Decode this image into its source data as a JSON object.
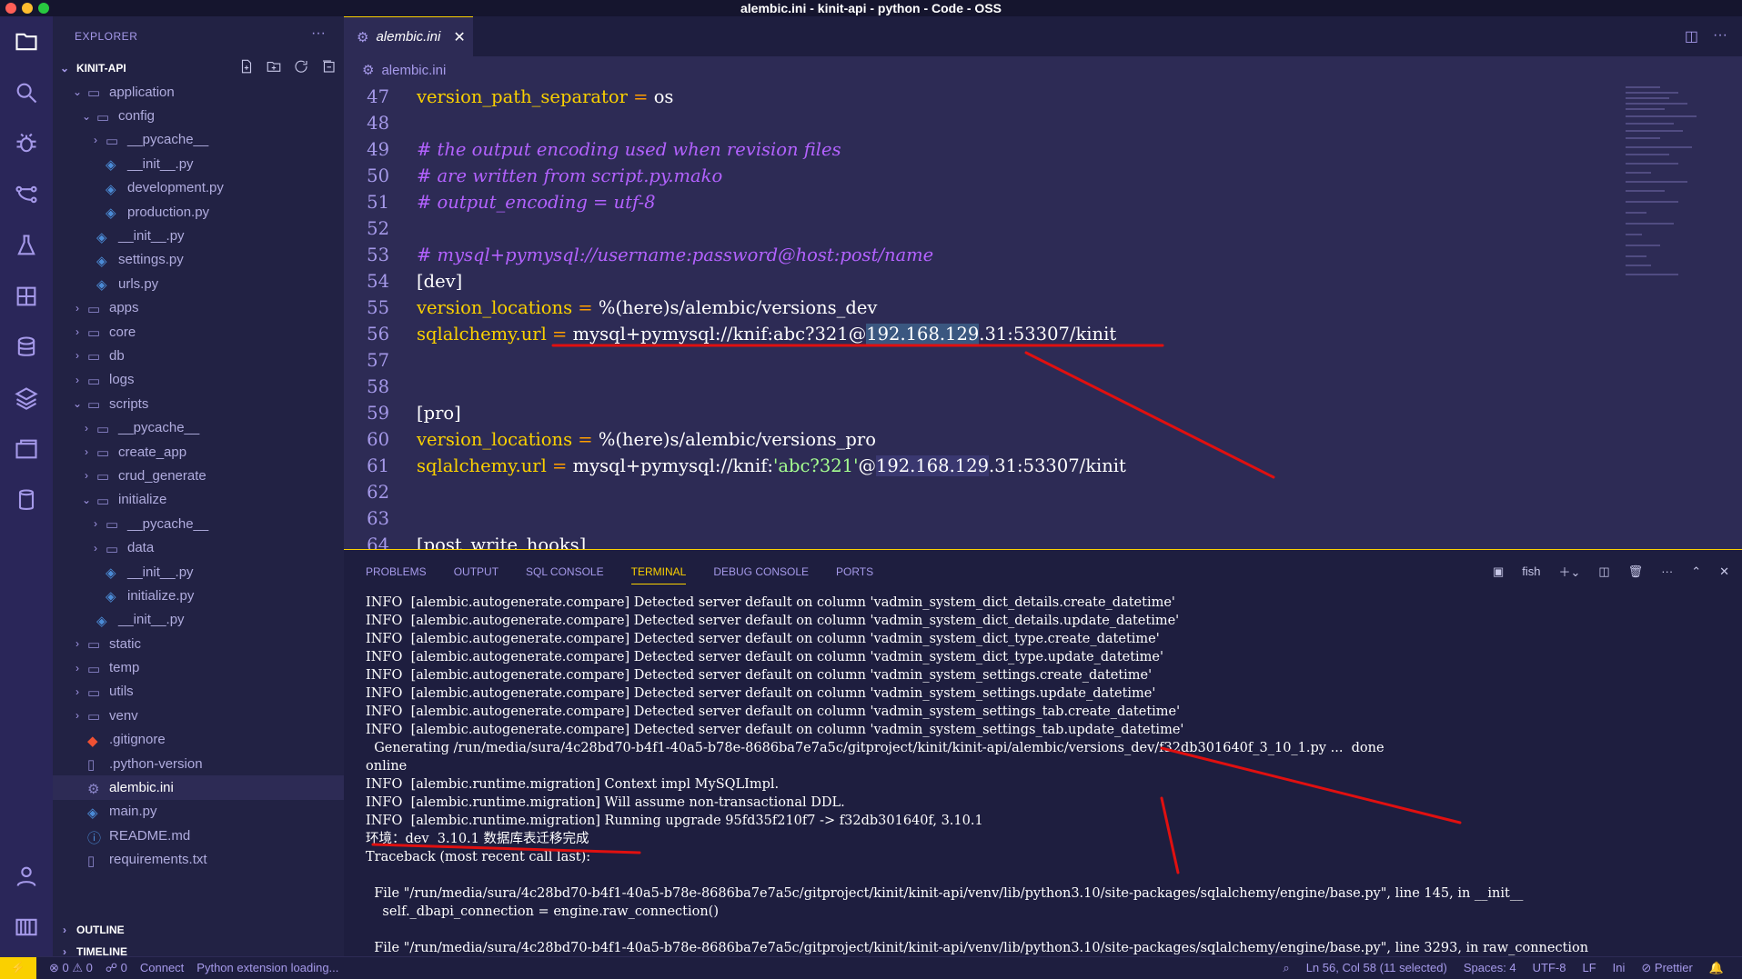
{
  "window": {
    "title": "alembic.ini - kinit-api - python - Code - OSS",
    "traffic_colors": [
      "#ff5f57",
      "#ffbd2e",
      "#28c840"
    ]
  },
  "colors": {
    "accent": "#fad000",
    "background": "#1e1e3f",
    "editor": "#2d2b55",
    "annotation": "#e01010"
  },
  "activity_bar": [
    "files-icon",
    "search-icon",
    "debug-icon",
    "source-control-icon",
    "testing-icon",
    "extensions-icon",
    "database-icon",
    "layers-icon",
    "remote-explorer-icon",
    "cylinder-icon",
    "account-icon",
    "settings-icon"
  ],
  "sidebar": {
    "header": "EXPLORER",
    "more": "···",
    "project": "KINIT-API",
    "tree": [
      {
        "label": "application",
        "depth": 1,
        "type": "folder",
        "open": true
      },
      {
        "label": "config",
        "depth": 2,
        "type": "folder",
        "open": true
      },
      {
        "label": "__pycache__",
        "depth": 3,
        "type": "folder",
        "open": false
      },
      {
        "label": "__init__.py",
        "depth": 3,
        "type": "py"
      },
      {
        "label": "development.py",
        "depth": 3,
        "type": "py"
      },
      {
        "label": "production.py",
        "depth": 3,
        "type": "py"
      },
      {
        "label": "__init__.py",
        "depth": 2,
        "type": "py"
      },
      {
        "label": "settings.py",
        "depth": 2,
        "type": "py"
      },
      {
        "label": "urls.py",
        "depth": 2,
        "type": "py"
      },
      {
        "label": "apps",
        "depth": 1,
        "type": "folder",
        "open": false
      },
      {
        "label": "core",
        "depth": 1,
        "type": "folder",
        "open": false
      },
      {
        "label": "db",
        "depth": 1,
        "type": "folder",
        "open": false
      },
      {
        "label": "logs",
        "depth": 1,
        "type": "folder",
        "open": false
      },
      {
        "label": "scripts",
        "depth": 1,
        "type": "folder",
        "open": true
      },
      {
        "label": "__pycache__",
        "depth": 2,
        "type": "folder",
        "open": false
      },
      {
        "label": "create_app",
        "depth": 2,
        "type": "folder",
        "open": false
      },
      {
        "label": "crud_generate",
        "depth": 2,
        "type": "folder",
        "open": false
      },
      {
        "label": "initialize",
        "depth": 2,
        "type": "folder",
        "open": true
      },
      {
        "label": "__pycache__",
        "depth": 3,
        "type": "folder",
        "open": false
      },
      {
        "label": "data",
        "depth": 3,
        "type": "folder",
        "open": false
      },
      {
        "label": "__init__.py",
        "depth": 3,
        "type": "py"
      },
      {
        "label": "initialize.py",
        "depth": 3,
        "type": "py"
      },
      {
        "label": "__init__.py",
        "depth": 2,
        "type": "py"
      },
      {
        "label": "static",
        "depth": 1,
        "type": "folder",
        "open": false
      },
      {
        "label": "temp",
        "depth": 1,
        "type": "folder",
        "open": false
      },
      {
        "label": "utils",
        "depth": 1,
        "type": "folder",
        "open": false
      },
      {
        "label": "venv",
        "depth": 1,
        "type": "folder",
        "open": false
      },
      {
        "label": ".gitignore",
        "depth": 1,
        "type": "git"
      },
      {
        "label": ".python-version",
        "depth": 1,
        "type": "file"
      },
      {
        "label": "alembic.ini",
        "depth": 1,
        "type": "gear",
        "selected": true
      },
      {
        "label": "main.py",
        "depth": 1,
        "type": "py"
      },
      {
        "label": "README.md",
        "depth": 1,
        "type": "info"
      },
      {
        "label": "requirements.txt",
        "depth": 1,
        "type": "file"
      }
    ],
    "outline": "OUTLINE",
    "timeline": "TIMELINE"
  },
  "editor": {
    "tab_label": "alembic.ini",
    "breadcrumb": "alembic.ini",
    "lines": [
      {
        "n": "47",
        "parts": [
          [
            "k",
            "version_path_separator"
          ],
          [
            "eq",
            " = "
          ],
          [
            "t",
            "os"
          ]
        ]
      },
      {
        "n": "48",
        "parts": []
      },
      {
        "n": "49",
        "parts": [
          [
            "cm",
            "# the output encoding used when revision files"
          ]
        ]
      },
      {
        "n": "50",
        "parts": [
          [
            "cm",
            "# are written from script.py.mako"
          ]
        ]
      },
      {
        "n": "51",
        "parts": [
          [
            "cm",
            "# output_encoding = utf-8"
          ]
        ]
      },
      {
        "n": "52",
        "parts": []
      },
      {
        "n": "53",
        "parts": [
          [
            "cm",
            "# mysql+pymysql://username:password@host:post/name"
          ]
        ]
      },
      {
        "n": "54",
        "parts": [
          [
            "t",
            "[dev]"
          ]
        ]
      },
      {
        "n": "55",
        "parts": [
          [
            "k",
            "version_locations"
          ],
          [
            "eq",
            " = "
          ],
          [
            "t",
            "%(here)s/alembic/versions_dev"
          ]
        ]
      },
      {
        "n": "56",
        "parts": [
          [
            "k",
            "sqlalchemy.url"
          ],
          [
            "eq",
            " = "
          ],
          [
            "t",
            "mysql+pymysql://knif:abc?321@"
          ],
          [
            "sel",
            "192.168.129"
          ],
          [
            "t",
            ".31:53307/kinit"
          ]
        ]
      },
      {
        "n": "57",
        "parts": []
      },
      {
        "n": "58",
        "parts": []
      },
      {
        "n": "59",
        "parts": [
          [
            "t",
            "[pro]"
          ]
        ]
      },
      {
        "n": "60",
        "parts": [
          [
            "k",
            "version_locations"
          ],
          [
            "eq",
            " = "
          ],
          [
            "t",
            "%(here)s/alembic/versions_pro"
          ]
        ]
      },
      {
        "n": "61",
        "parts": [
          [
            "k",
            "sqlalchemy.url"
          ],
          [
            "eq",
            " = "
          ],
          [
            "t",
            "mysql+pymysql://knif:"
          ],
          [
            "st",
            "'abc?321'"
          ],
          [
            "t",
            "@"
          ],
          [
            "hl",
            "192.168.129"
          ],
          [
            "t",
            ".31:53307/kinit"
          ]
        ]
      },
      {
        "n": "62",
        "parts": []
      },
      {
        "n": "63",
        "parts": []
      },
      {
        "n": "64",
        "parts": [
          [
            "t",
            "[post_write_hooks]"
          ]
        ]
      }
    ]
  },
  "panel": {
    "tabs": [
      "PROBLEMS",
      "OUTPUT",
      "SQL CONSOLE",
      "TERMINAL",
      "DEBUG CONSOLE",
      "PORTS"
    ],
    "active_tab": "TERMINAL",
    "shell": "fish",
    "terminal_lines": [
      "INFO  [alembic.autogenerate.compare] Detected server default on column 'vadmin_system_dict_details.create_datetime'",
      "INFO  [alembic.autogenerate.compare] Detected server default on column 'vadmin_system_dict_details.update_datetime'",
      "INFO  [alembic.autogenerate.compare] Detected server default on column 'vadmin_system_dict_type.create_datetime'",
      "INFO  [alembic.autogenerate.compare] Detected server default on column 'vadmin_system_dict_type.update_datetime'",
      "INFO  [alembic.autogenerate.compare] Detected server default on column 'vadmin_system_settings.create_datetime'",
      "INFO  [alembic.autogenerate.compare] Detected server default on column 'vadmin_system_settings.update_datetime'",
      "INFO  [alembic.autogenerate.compare] Detected server default on column 'vadmin_system_settings_tab.create_datetime'",
      "INFO  [alembic.autogenerate.compare] Detected server default on column 'vadmin_system_settings_tab.update_datetime'",
      "  Generating /run/media/sura/4c28bd70-b4f1-40a5-b78e-8686ba7e7a5c/gitproject/kinit/kinit-api/alembic/versions_dev/f32db301640f_3_10_1.py ...  done",
      "online",
      "INFO  [alembic.runtime.migration] Context impl MySQLImpl.",
      "INFO  [alembic.runtime.migration] Will assume non-transactional DDL.",
      "INFO  [alembic.runtime.migration] Running upgrade 95fd35f210f7 -> f32db301640f, 3.10.1",
      "环境：dev  3.10.1 数据库表迁移完成",
      "Traceback (most recent call last):",
      "",
      "  File \"/run/media/sura/4c28bd70-b4f1-40a5-b78e-8686ba7e7a5c/gitproject/kinit/kinit-api/venv/lib/python3.10/site-packages/sqlalchemy/engine/base.py\", line 145, in __init__",
      "    self._dbapi_connection = engine.raw_connection()",
      "",
      "  File \"/run/media/sura/4c28bd70-b4f1-40a5-b78e-8686ba7e7a5c/gitproject/kinit/kinit-api/venv/lib/python3.10/site-packages/sqlalchemy/engine/base.py\", line 3293, in raw_connection"
    ]
  },
  "status": {
    "remote": "⚡",
    "problems": "⊗ 0 ⚠ 0",
    "ports": "☍ 0",
    "connect": "Connect",
    "python": "Python extension loading...",
    "cursor": "Ln 56, Col 58 (11 selected)",
    "spaces": "Spaces: 4",
    "encoding": "UTF-8",
    "eol": "LF",
    "language": "Ini",
    "formatter": "⊘ Prettier"
  }
}
